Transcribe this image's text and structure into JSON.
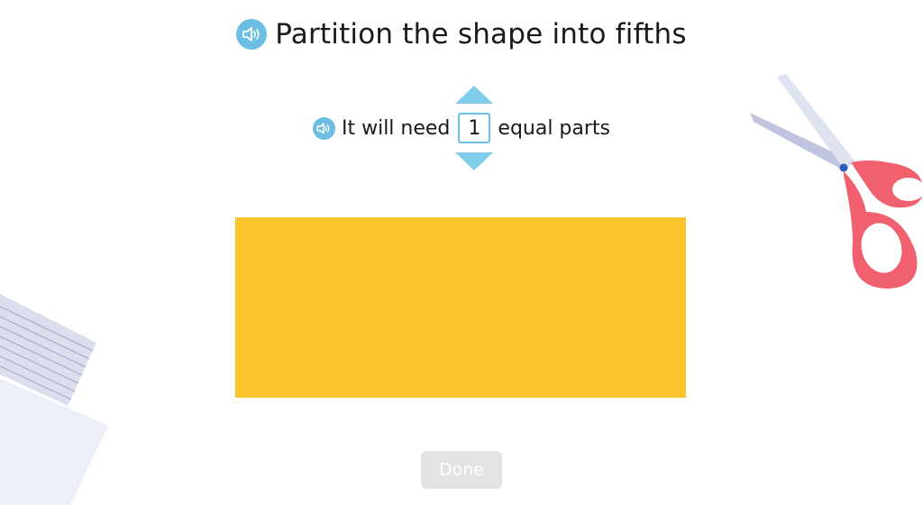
{
  "title": "Partition the shape into fifths",
  "instruction": {
    "before": "It will need",
    "count": "1",
    "after": "equal parts"
  },
  "shape": {
    "color": "#fbc42d"
  },
  "done_label": "Done",
  "colors": {
    "accent": "#6cbfe3",
    "arrow": "#7fcdea",
    "done_bg": "#e3e3e3"
  },
  "icons": {
    "title_audio": "speaker-icon",
    "instruction_audio": "speaker-icon",
    "increment": "triangle-up-icon",
    "decrement": "triangle-down-icon",
    "decoration_left": "notebook-paper-icon",
    "decoration_right": "scissors-icon"
  }
}
